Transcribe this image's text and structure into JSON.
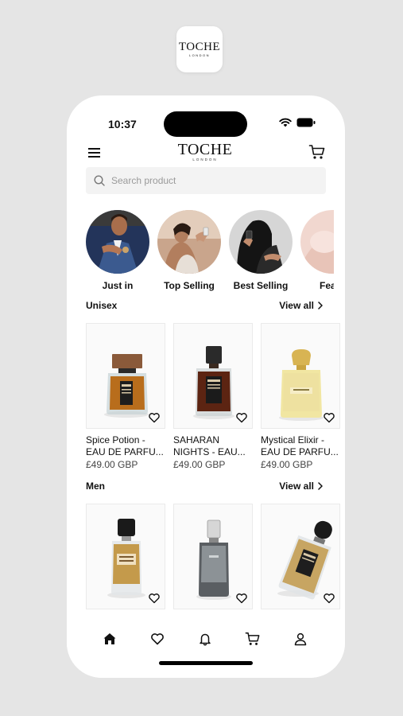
{
  "app_logo": {
    "brand": "TOCHE",
    "sub": "LONDON"
  },
  "status_bar": {
    "time": "10:37"
  },
  "header": {
    "brand": "TOCHE",
    "sub": "LONDON"
  },
  "search": {
    "placeholder": "Search product"
  },
  "categories": [
    {
      "label": "Just in"
    },
    {
      "label": "Top Selling"
    },
    {
      "label": "Best Selling"
    },
    {
      "label": "Featu"
    }
  ],
  "sections": [
    {
      "title": "Unisex",
      "view_all": "View all",
      "products": [
        {
          "name1": "Spice Potion -",
          "name2": "EAU DE PARFU...",
          "price": "£49.00 GBP"
        },
        {
          "name1": "SAHARAN",
          "name2": "NIGHTS - EAU...",
          "price": "£49.00 GBP"
        },
        {
          "name1": "Mystical Elixir -",
          "name2": "EAU DE PARFU...",
          "price": "£49.00 GBP"
        }
      ]
    },
    {
      "title": "Men",
      "view_all": "View all"
    }
  ],
  "tabbar": [
    "home-icon",
    "heart-icon",
    "bell-icon",
    "cart-icon",
    "user-icon"
  ]
}
